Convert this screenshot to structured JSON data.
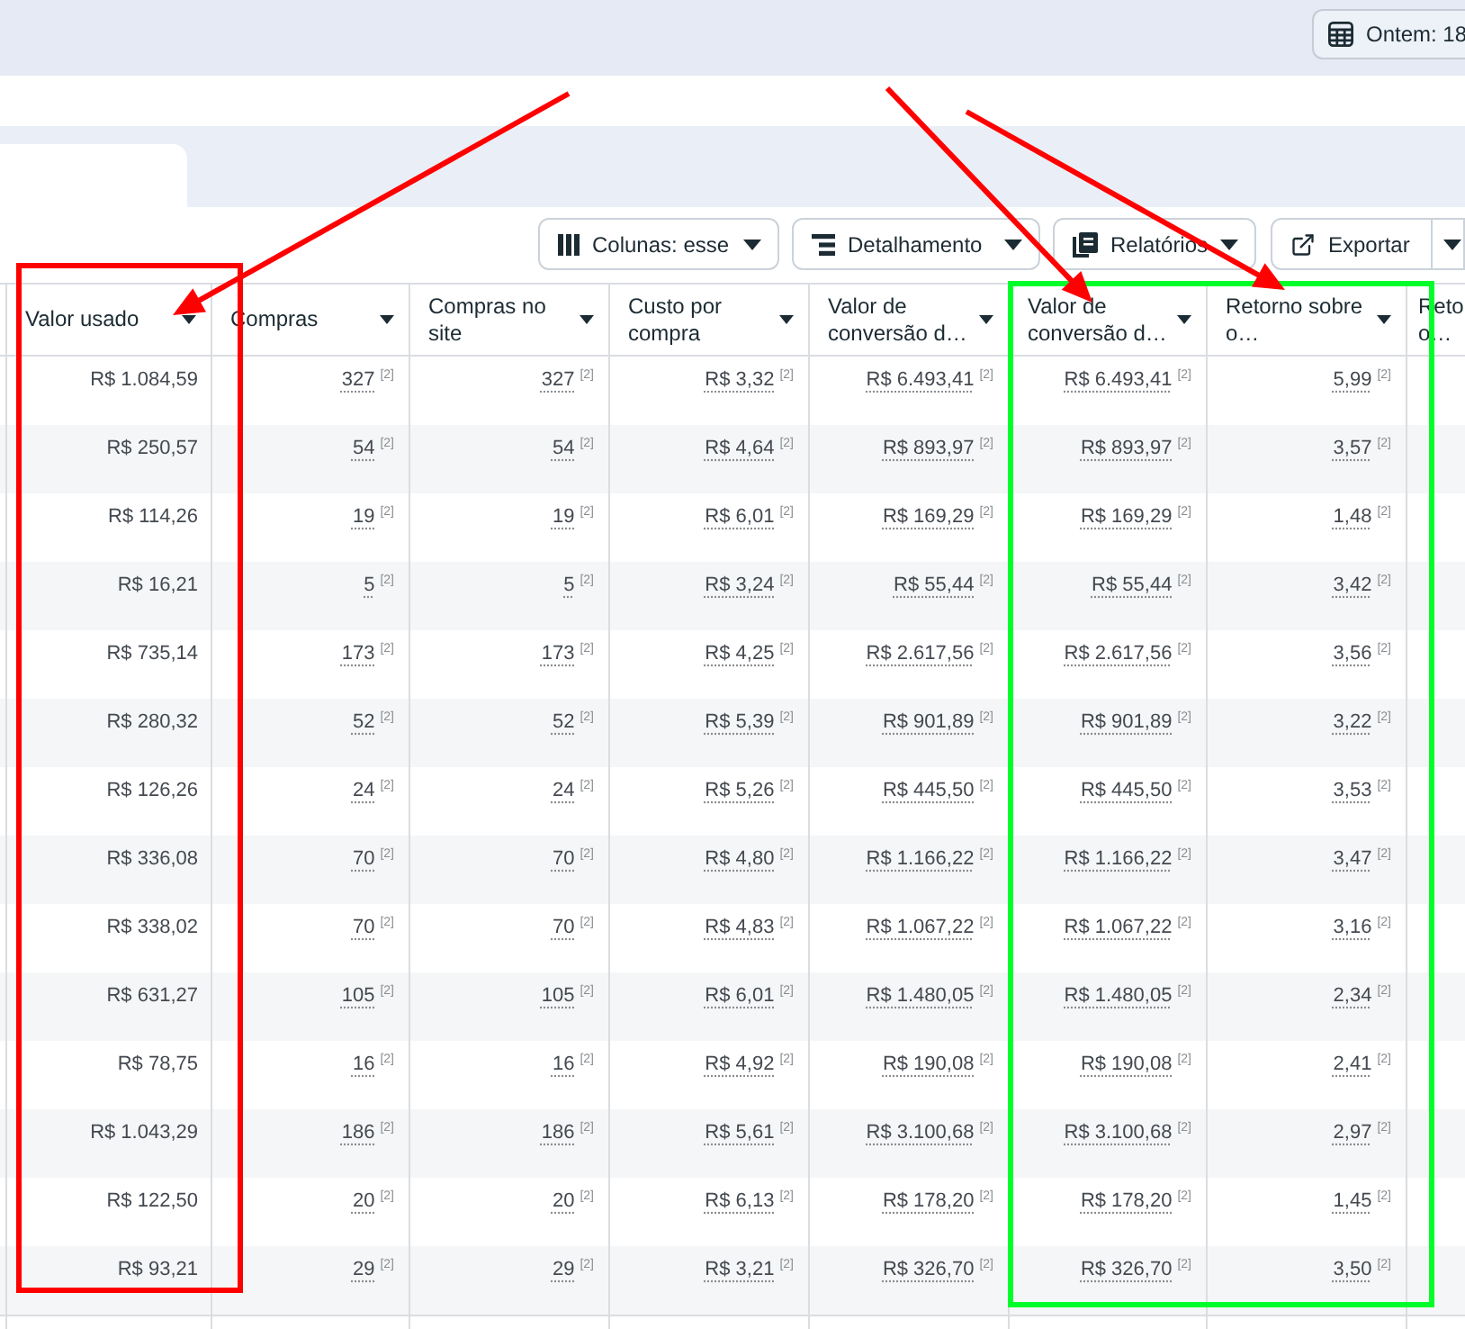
{
  "top_bar": {
    "date_button": {
      "label": "Ontem: 18"
    }
  },
  "toolbar": {
    "buttons": [
      {
        "kind": "columns",
        "label": "Colunas: esse",
        "menu": true
      },
      {
        "kind": "breakdown",
        "label": "Detalhamento",
        "menu": true
      },
      {
        "kind": "reports",
        "label": "Relatórios",
        "menu": true
      },
      {
        "kind": "export",
        "label": "Exportar",
        "menu": false
      },
      {
        "kind": "more",
        "menu": true
      }
    ]
  },
  "table": {
    "columns": [
      {
        "lines": [
          "Valor usado"
        ],
        "menu": true
      },
      {
        "lines": [
          "Compras"
        ],
        "menu": true
      },
      {
        "lines": [
          "Compras no",
          "site"
        ],
        "menu": true
      },
      {
        "lines": [
          "Custo por",
          "compra"
        ],
        "menu": true
      },
      {
        "lines": [
          "Valor de",
          "conversão d…"
        ],
        "menu": true
      },
      {
        "lines": [
          "Valor de",
          "conversão d…"
        ],
        "menu": true
      },
      {
        "lines": [
          "Retorno sobre",
          "o…"
        ],
        "menu": true
      },
      {
        "lines": [
          "Reto",
          "o…"
        ],
        "menu": false
      }
    ],
    "rows": [
      {
        "cells": [
          {
            "value": "R$ 1.084,59"
          },
          {
            "value": "327",
            "note": "[2]"
          },
          {
            "value": "327",
            "note": "[2]"
          },
          {
            "value": "R$ 3,32",
            "note": "[2]"
          },
          {
            "value": "R$ 6.493,41",
            "note": "[2]"
          },
          {
            "value": "R$ 6.493,41",
            "note": "[2]"
          },
          {
            "value": "5,99",
            "note": "[2]"
          }
        ]
      },
      {
        "cells": [
          {
            "value": "R$ 250,57"
          },
          {
            "value": "54",
            "note": "[2]"
          },
          {
            "value": "54",
            "note": "[2]"
          },
          {
            "value": "R$ 4,64",
            "note": "[2]"
          },
          {
            "value": "R$ 893,97",
            "note": "[2]"
          },
          {
            "value": "R$ 893,97",
            "note": "[2]"
          },
          {
            "value": "3,57",
            "note": "[2]"
          }
        ]
      },
      {
        "cells": [
          {
            "value": "R$ 114,26"
          },
          {
            "value": "19",
            "note": "[2]"
          },
          {
            "value": "19",
            "note": "[2]"
          },
          {
            "value": "R$ 6,01",
            "note": "[2]"
          },
          {
            "value": "R$ 169,29",
            "note": "[2]"
          },
          {
            "value": "R$ 169,29",
            "note": "[2]"
          },
          {
            "value": "1,48",
            "note": "[2]"
          }
        ]
      },
      {
        "cells": [
          {
            "value": "R$ 16,21"
          },
          {
            "value": "5",
            "note": "[2]"
          },
          {
            "value": "5",
            "note": "[2]"
          },
          {
            "value": "R$ 3,24",
            "note": "[2]"
          },
          {
            "value": "R$ 55,44",
            "note": "[2]"
          },
          {
            "value": "R$ 55,44",
            "note": "[2]"
          },
          {
            "value": "3,42",
            "note": "[2]"
          }
        ]
      },
      {
        "cells": [
          {
            "value": "R$ 735,14"
          },
          {
            "value": "173",
            "note": "[2]"
          },
          {
            "value": "173",
            "note": "[2]"
          },
          {
            "value": "R$ 4,25",
            "note": "[2]"
          },
          {
            "value": "R$ 2.617,56",
            "note": "[2]"
          },
          {
            "value": "R$ 2.617,56",
            "note": "[2]"
          },
          {
            "value": "3,56",
            "note": "[2]"
          }
        ]
      },
      {
        "cells": [
          {
            "value": "R$ 280,32"
          },
          {
            "value": "52",
            "note": "[2]"
          },
          {
            "value": "52",
            "note": "[2]"
          },
          {
            "value": "R$ 5,39",
            "note": "[2]"
          },
          {
            "value": "R$ 901,89",
            "note": "[2]"
          },
          {
            "value": "R$ 901,89",
            "note": "[2]"
          },
          {
            "value": "3,22",
            "note": "[2]"
          }
        ]
      },
      {
        "cells": [
          {
            "value": "R$ 126,26"
          },
          {
            "value": "24",
            "note": "[2]"
          },
          {
            "value": "24",
            "note": "[2]"
          },
          {
            "value": "R$ 5,26",
            "note": "[2]"
          },
          {
            "value": "R$ 445,50",
            "note": "[2]"
          },
          {
            "value": "R$ 445,50",
            "note": "[2]"
          },
          {
            "value": "3,53",
            "note": "[2]"
          }
        ]
      },
      {
        "cells": [
          {
            "value": "R$ 336,08"
          },
          {
            "value": "70",
            "note": "[2]"
          },
          {
            "value": "70",
            "note": "[2]"
          },
          {
            "value": "R$ 4,80",
            "note": "[2]"
          },
          {
            "value": "R$ 1.166,22",
            "note": "[2]"
          },
          {
            "value": "R$ 1.166,22",
            "note": "[2]"
          },
          {
            "value": "3,47",
            "note": "[2]"
          }
        ]
      },
      {
        "cells": [
          {
            "value": "R$ 338,02"
          },
          {
            "value": "70",
            "note": "[2]"
          },
          {
            "value": "70",
            "note": "[2]"
          },
          {
            "value": "R$ 4,83",
            "note": "[2]"
          },
          {
            "value": "R$ 1.067,22",
            "note": "[2]"
          },
          {
            "value": "R$ 1.067,22",
            "note": "[2]"
          },
          {
            "value": "3,16",
            "note": "[2]"
          }
        ]
      },
      {
        "cells": [
          {
            "value": "R$ 631,27"
          },
          {
            "value": "105",
            "note": "[2]"
          },
          {
            "value": "105",
            "note": "[2]"
          },
          {
            "value": "R$ 6,01",
            "note": "[2]"
          },
          {
            "value": "R$ 1.480,05",
            "note": "[2]"
          },
          {
            "value": "R$ 1.480,05",
            "note": "[2]"
          },
          {
            "value": "2,34",
            "note": "[2]"
          }
        ]
      },
      {
        "cells": [
          {
            "value": "R$ 78,75"
          },
          {
            "value": "16",
            "note": "[2]"
          },
          {
            "value": "16",
            "note": "[2]"
          },
          {
            "value": "R$ 4,92",
            "note": "[2]"
          },
          {
            "value": "R$ 190,08",
            "note": "[2]"
          },
          {
            "value": "R$ 190,08",
            "note": "[2]"
          },
          {
            "value": "2,41",
            "note": "[2]"
          }
        ]
      },
      {
        "cells": [
          {
            "value": "R$ 1.043,29"
          },
          {
            "value": "186",
            "note": "[2]"
          },
          {
            "value": "186",
            "note": "[2]"
          },
          {
            "value": "R$ 5,61",
            "note": "[2]"
          },
          {
            "value": "R$ 3.100,68",
            "note": "[2]"
          },
          {
            "value": "R$ 3.100,68",
            "note": "[2]"
          },
          {
            "value": "2,97",
            "note": "[2]"
          }
        ]
      },
      {
        "cells": [
          {
            "value": "R$ 122,50"
          },
          {
            "value": "20",
            "note": "[2]"
          },
          {
            "value": "20",
            "note": "[2]"
          },
          {
            "value": "R$ 6,13",
            "note": "[2]"
          },
          {
            "value": "R$ 178,20",
            "note": "[2]"
          },
          {
            "value": "R$ 178,20",
            "note": "[2]"
          },
          {
            "value": "1,45",
            "note": "[2]"
          }
        ]
      },
      {
        "cells": [
          {
            "value": "R$ 93,21"
          },
          {
            "value": "29",
            "note": "[2]"
          },
          {
            "value": "29",
            "note": "[2]"
          },
          {
            "value": "R$ 3,21",
            "note": "[2]"
          },
          {
            "value": "R$ 326,70",
            "note": "[2]"
          },
          {
            "value": "R$ 326,70",
            "note": "[2]"
          },
          {
            "value": "3,50",
            "note": "[2]"
          }
        ]
      }
    ]
  }
}
